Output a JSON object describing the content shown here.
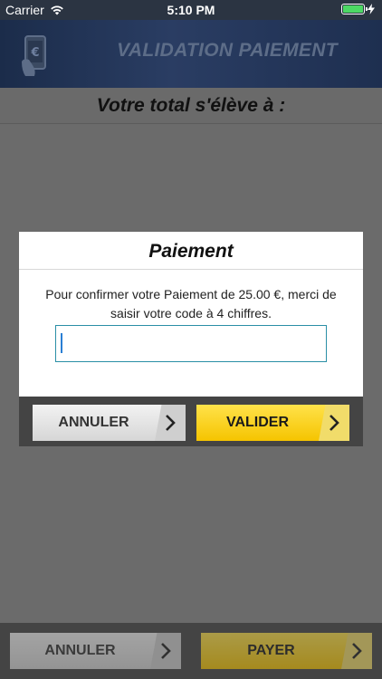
{
  "status_bar": {
    "carrier": "Carrier",
    "time": "5:10 PM"
  },
  "header": {
    "title": "VALIDATION PAIEMENT",
    "icon": "phone-euro-icon"
  },
  "total": {
    "label": "Votre total s'élève à :"
  },
  "modal": {
    "title": "Paiement",
    "message": "Pour confirmer votre Paiement de 25.00 €, merci de saisir votre code à 4 chiffres.",
    "input_value": "",
    "cancel_label": "ANNULER",
    "validate_label": "VALIDER"
  },
  "bottom": {
    "cancel_label": "ANNULER",
    "pay_label": "PAYER"
  },
  "colors": {
    "accent_yellow": "#f5c400",
    "header_blue": "#1b2c4a",
    "input_border": "#2a8fa6"
  }
}
